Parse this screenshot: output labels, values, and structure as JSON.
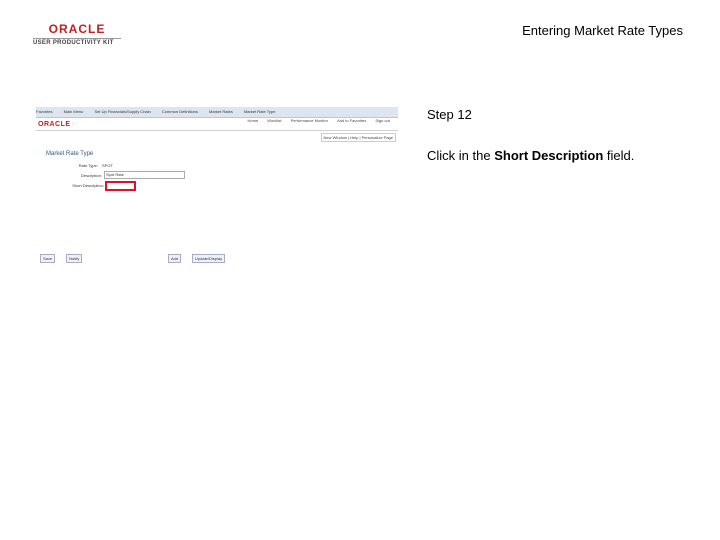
{
  "header": {
    "logo_oracle": "ORACLE",
    "logo_upk": "USER PRODUCTIVITY KIT",
    "title": "Entering Market Rate Types"
  },
  "screenshot": {
    "nav_items": [
      "Favorites",
      "Main Menu",
      "Set Up Financials/Supply Chain",
      "Common Definitions",
      "Market Rates",
      "Market Rate Type"
    ],
    "sub_nav": [
      "Home",
      "Worklist",
      "Performance Monitor",
      "Add to Favorites",
      "Sign out"
    ],
    "oracle_label": "ORACLE",
    "new_window": "New Window | Help | Personalize Page",
    "form_title": "Market Rate Type",
    "fields": {
      "rate_type_label": "Rate Type:",
      "rate_type_value": "SPOT",
      "description_label": "Description:",
      "description_value": "Spot Rate",
      "short_desc_label": "Short Description:"
    },
    "buttons": {
      "save": "Save",
      "notify": "Notify",
      "add": "Add",
      "update": "Update/Display"
    }
  },
  "step": {
    "title": "Step 12",
    "instruction_prefix": "Click in the ",
    "instruction_bold": "Short Description",
    "instruction_suffix": " field."
  }
}
